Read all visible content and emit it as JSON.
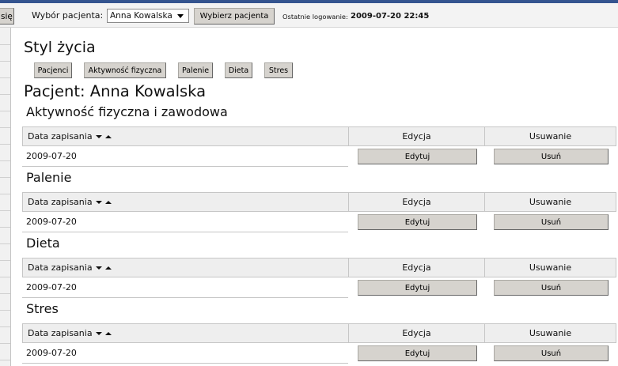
{
  "header": {
    "partial_button_label": "się",
    "patient_select_label": "Wybór pacjenta:",
    "patient_select_value": "Anna Kowalska",
    "select_patient_button": "Wybierz pacjenta",
    "last_login_label": "Ostatnie logowanie:",
    "last_login_value": "2009-07-20 22:45"
  },
  "page": {
    "title": "Styl życia",
    "patient_heading": "Pacjent: Anna Kowalska"
  },
  "nav": {
    "buttons": [
      "Pacjenci",
      "Aktywność fizyczna",
      "Palenie",
      "Dieta",
      "Stres"
    ]
  },
  "sections": [
    {
      "title": "Aktywność fizyczna i zawodowa",
      "columns": {
        "date": "Data zapisania",
        "edit": "Edycja",
        "delete": "Usuwanie"
      },
      "rows": [
        {
          "date": "2009-07-20",
          "edit_button": "Edytuj",
          "delete_button": "Usuń"
        }
      ]
    },
    {
      "title": "Palenie",
      "columns": {
        "date": "Data zapisania",
        "edit": "Edycja",
        "delete": "Usuwanie"
      },
      "rows": [
        {
          "date": "2009-07-20",
          "edit_button": "Edytuj",
          "delete_button": "Usuń"
        }
      ]
    },
    {
      "title": "Dieta",
      "columns": {
        "date": "Data zapisania",
        "edit": "Edycja",
        "delete": "Usuwanie"
      },
      "rows": [
        {
          "date": "2009-07-20",
          "edit_button": "Edytuj",
          "delete_button": "Usuń"
        }
      ]
    },
    {
      "title": "Stres",
      "columns": {
        "date": "Data zapisania",
        "edit": "Edycja",
        "delete": "Usuwanie"
      },
      "rows": [
        {
          "date": "2009-07-20",
          "edit_button": "Edytuj",
          "delete_button": "Usuń"
        }
      ]
    }
  ],
  "icons": {
    "sort_descending": "sort-desc-icon",
    "sort_ascending": "sort-asc-icon",
    "select_dropdown": "dropdown-arrow-icon"
  },
  "colors": {
    "top_bar": "#34548f",
    "header_background": "#f3f3f3",
    "button_face": "#d6d3ce",
    "table_header": "#eeeeee"
  }
}
